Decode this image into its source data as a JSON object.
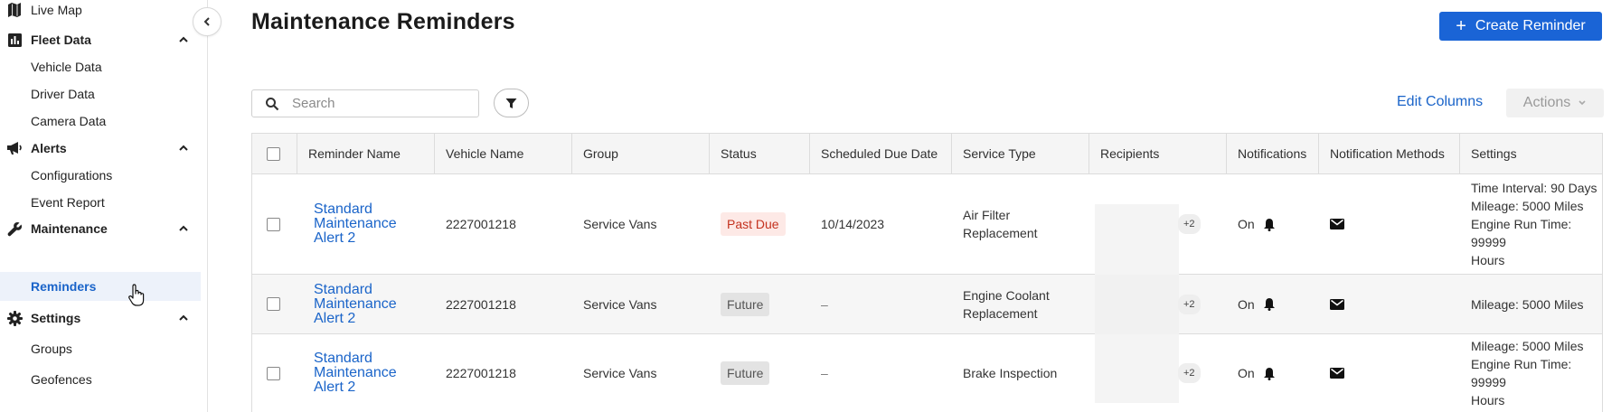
{
  "sidebar": {
    "items": [
      {
        "label": "Live Map"
      },
      {
        "label": "Fleet Data"
      },
      {
        "label": "Vehicle Data"
      },
      {
        "label": "Driver Data"
      },
      {
        "label": "Camera Data"
      },
      {
        "label": "Alerts"
      },
      {
        "label": "Configurations"
      },
      {
        "label": "Event Report"
      },
      {
        "label": "Maintenance"
      },
      {
        "label": "Reminders"
      },
      {
        "label": "Settings"
      },
      {
        "label": "Groups"
      },
      {
        "label": "Geofences"
      }
    ],
    "active_item": "Reminders"
  },
  "header": {
    "title": "Maintenance Reminders",
    "create_button_label": "Create Reminder"
  },
  "toolbar": {
    "search_placeholder": "Search",
    "edit_columns_label": "Edit Columns",
    "actions_label": "Actions"
  },
  "table": {
    "columns": [
      "Reminder Name",
      "Vehicle Name",
      "Group",
      "Status",
      "Scheduled Due Date",
      "Service Type",
      "Recipients",
      "Notifications",
      "Notification Methods",
      "Settings"
    ],
    "rows": [
      {
        "reminder_name": [
          "Standard",
          "Maintenance",
          "Alert 2"
        ],
        "vehicle_name": "2227001218",
        "group": "Service Vans",
        "status": "Past Due",
        "due_date": "10/14/2023",
        "service_type": [
          "Air Filter",
          "Replacement"
        ],
        "recipients_more": "+2",
        "notifications": "On",
        "settings": [
          "Time Interval: 90 Days",
          "Mileage: 5000 Miles",
          "Engine Run Time: 99999",
          "Hours"
        ]
      },
      {
        "reminder_name": [
          "Standard",
          "Maintenance",
          "Alert 2"
        ],
        "vehicle_name": "2227001218",
        "group": "Service Vans",
        "status": "Future",
        "due_date": "–",
        "service_type": [
          "Engine Coolant",
          "Replacement"
        ],
        "recipients_more": "+2",
        "notifications": "On",
        "settings": [
          "Mileage: 5000 Miles"
        ]
      },
      {
        "reminder_name": [
          "Standard",
          "Maintenance",
          "Alert 2"
        ],
        "vehicle_name": "2227001218",
        "group": "Service Vans",
        "status": "Future",
        "due_date": "–",
        "service_type": [
          "Brake Inspection"
        ],
        "recipients_more": "+2",
        "notifications": "On",
        "settings": [
          "Mileage: 5000 Miles",
          "Engine Run Time: 99999",
          "Hours"
        ]
      }
    ]
  },
  "colors": {
    "accent": "#1a64d6",
    "link": "#1a64c9",
    "past_due_bg": "#fde9e6",
    "past_due_text": "#c4321f",
    "future_bg": "#e3e3e3"
  }
}
